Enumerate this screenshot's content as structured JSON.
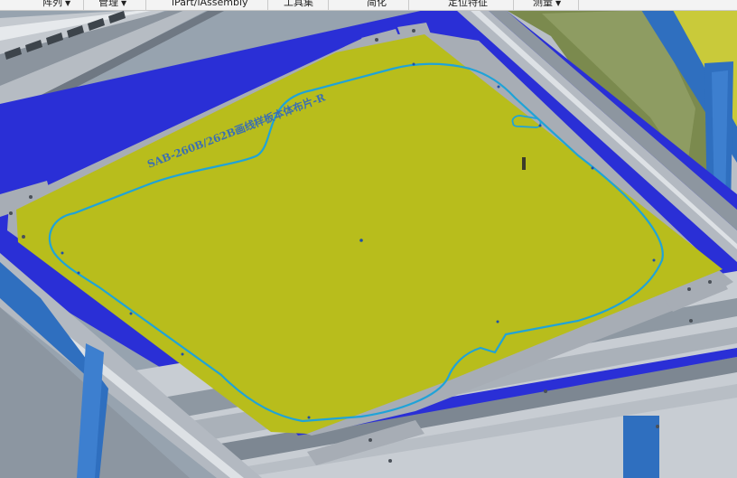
{
  "ribbon": {
    "tabs": [
      {
        "label": "阵列",
        "dropdown": true
      },
      {
        "label": "管理",
        "dropdown": true
      },
      {
        "label": "iPart/iAssembly",
        "dropdown": false
      },
      {
        "label": "工具集",
        "dropdown": false
      },
      {
        "label": "简化",
        "dropdown": false
      },
      {
        "label": "定位特征",
        "dropdown": false
      },
      {
        "label": "测量",
        "dropdown": true
      }
    ],
    "caret": "▼"
  },
  "model": {
    "engraved_text": "SAB-260B/262B画线样板本体布片-R",
    "colors": {
      "board": "#b8bd1c",
      "base_blue": "#2a2fd6",
      "frame_blue": "#2f6fbf",
      "rail_gray": "#a9afb8",
      "outline_cyan": "#1fa3d8",
      "side_panel": "#7b8a4e"
    }
  }
}
